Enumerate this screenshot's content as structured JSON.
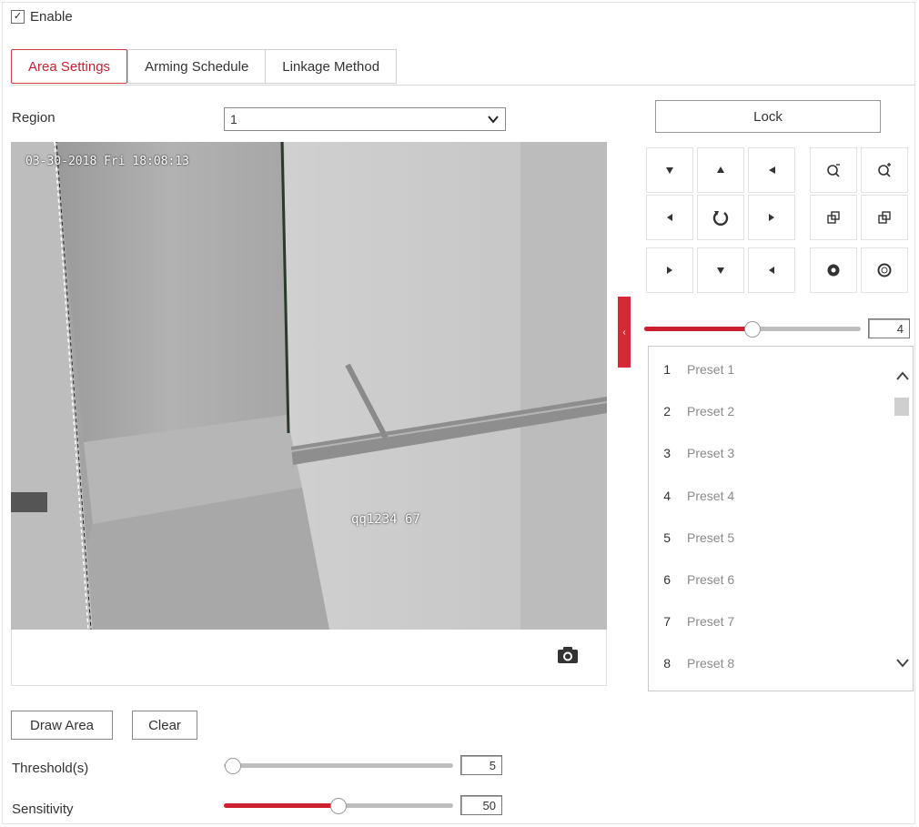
{
  "enable": {
    "label": "Enable",
    "checked": true
  },
  "tabs": [
    {
      "label": "Area Settings",
      "active": true
    },
    {
      "label": "Arming Schedule",
      "active": false
    },
    {
      "label": "Linkage Method",
      "active": false
    }
  ],
  "region": {
    "label": "Region",
    "value": "1"
  },
  "video": {
    "timestamp": "03-30-2018 Fri 18:08:13",
    "osd_name": "qq1234 67",
    "snapshot_icon": "camera-icon"
  },
  "ptz": {
    "lock_label": "Lock",
    "speed": {
      "value": "4",
      "level": 0.5,
      "min": 1,
      "max": 7
    },
    "controls": [
      "pan-up-left-icon",
      "pan-up-icon",
      "pan-up-right-icon",
      "zoom-out-icon",
      "zoom-in-icon",
      "pan-left-icon",
      "auto-rotate-icon",
      "pan-right-icon",
      "focus-near-icon",
      "focus-far-icon",
      "pan-down-left-icon",
      "pan-down-icon",
      "pan-down-right-icon",
      "iris-close-icon",
      "iris-open-icon"
    ]
  },
  "presets": [
    {
      "num": "1",
      "name": "Preset 1"
    },
    {
      "num": "2",
      "name": "Preset 2"
    },
    {
      "num": "3",
      "name": "Preset 3"
    },
    {
      "num": "4",
      "name": "Preset 4"
    },
    {
      "num": "5",
      "name": "Preset 5"
    },
    {
      "num": "6",
      "name": "Preset 6"
    },
    {
      "num": "7",
      "name": "Preset 7"
    },
    {
      "num": "8",
      "name": "Preset 8"
    }
  ],
  "actions": {
    "draw_label": "Draw Area",
    "clear_label": "Clear"
  },
  "threshold": {
    "label": "Threshold(s)",
    "value": "5",
    "level": 0.0
  },
  "sensitivity": {
    "label": "Sensitivity",
    "value": "50",
    "level": 0.5
  },
  "colors": {
    "accent": "#cc2030",
    "border": "#cfcfcf"
  }
}
